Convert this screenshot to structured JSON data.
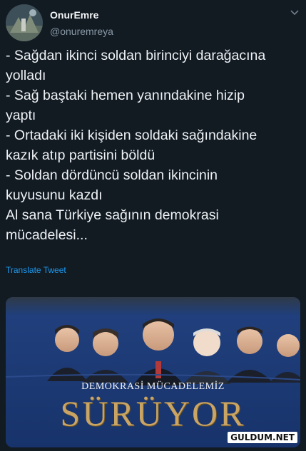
{
  "user": {
    "display_name": "OnurEmre",
    "handle": "@onuremreya"
  },
  "tweet": {
    "lines": [
      "- Sağdan ikinci soldan birinciyi darağacına",
      "yolladı",
      "- Sağ baştaki hemen yanındakine hizip",
      "yaptı",
      "- Ortadaki iki kişiden soldaki sağındakine",
      "kazık atıp partisini böldü",
      "- Soldan dördüncü soldan ikincinin",
      "kuyusunu kazdı",
      "Al sana Türkiye sağının demokrasi",
      "mücadelesi..."
    ],
    "translate_label": "Translate Tweet"
  },
  "media": {
    "banner_subtitle": "DEMOKRASİ MÜCADELEMİZ",
    "banner_title": "SÜRÜYOR",
    "watermark": "GULDUM.NET"
  },
  "icons": {
    "menu": "chevron-down-icon"
  },
  "colors": {
    "background": "#121a22",
    "text": "#eef2f5",
    "secondary": "#8899a6",
    "link": "#1d9bf0",
    "banner_blue": "#1b3a78",
    "banner_gold": "#c9a463"
  }
}
